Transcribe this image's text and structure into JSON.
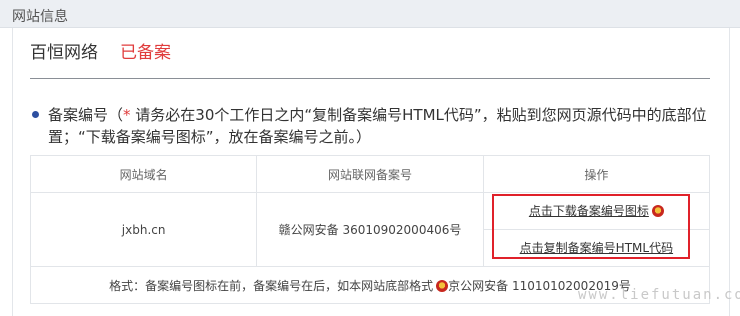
{
  "header": {
    "title": "网站信息"
  },
  "site": {
    "brand": "百恒网络",
    "status": "已备案"
  },
  "notice": {
    "label": "备案编号（",
    "star": "*",
    "text": " 请务必在30个工作日之内“复制备案编号HTML代码”，粘贴到您网页源代码中的底部位置；“下载备案编号图标”，放在备案编号之前。）"
  },
  "table": {
    "headers": [
      "网站域名",
      "网站联网备案号",
      "操作"
    ],
    "row": {
      "domain": "jxbh.cn",
      "record": "赣公网安备 36010902000406号",
      "actions": [
        "点击下载备案编号图标",
        "点击复制备案编号HTML代码"
      ]
    },
    "footer": {
      "prefix": "格式：备案编号图标在前，备案编号在后，如本网站底部格式",
      "example": "京公网安备 11010102002019号"
    }
  },
  "watermark": "www.liefutuan.com",
  "colors": {
    "accent_red": "#e03c3c",
    "highlight_red": "#e0212a",
    "bullet_blue": "#2d4fa0"
  }
}
